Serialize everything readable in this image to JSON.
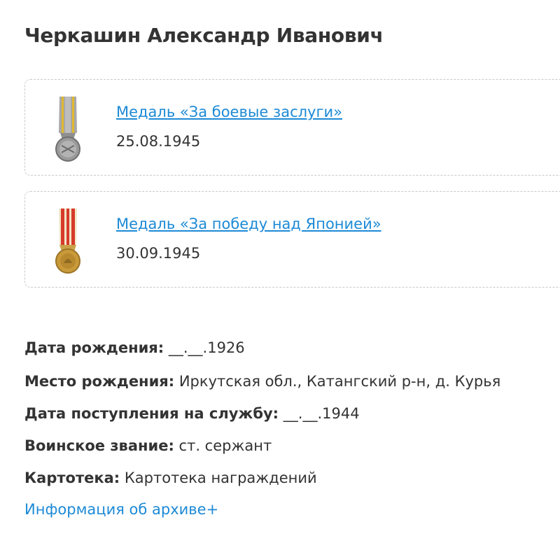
{
  "person": {
    "name": "Черкашин Александр Иванович"
  },
  "awards": [
    {
      "title": "Медаль «За боевые заслуги»",
      "date": "25.08.1945",
      "icon": "medal-combat-merit-icon"
    },
    {
      "title": "Медаль «За победу над Японией»",
      "date": "30.09.1945",
      "icon": "medal-victory-japan-icon"
    }
  ],
  "details": {
    "birth_date_label": "Дата рождения:",
    "birth_date_value": " __.__.1926",
    "birth_place_label": "Место рождения:",
    "birth_place_value": " Иркутская обл., Катангский р-н, д. Курья",
    "service_start_label": "Дата поступления на службу:",
    "service_start_value": " __.__.1944",
    "rank_label": "Воинское звание:",
    "rank_value": " ст. сержант",
    "card_file_label": "Картотека:",
    "card_file_value": " Картотека награждений"
  },
  "archive_link": "Информация об архиве+",
  "colors": {
    "link": "#1d8ad6",
    "text": "#333333",
    "border": "#c9c9c9"
  }
}
